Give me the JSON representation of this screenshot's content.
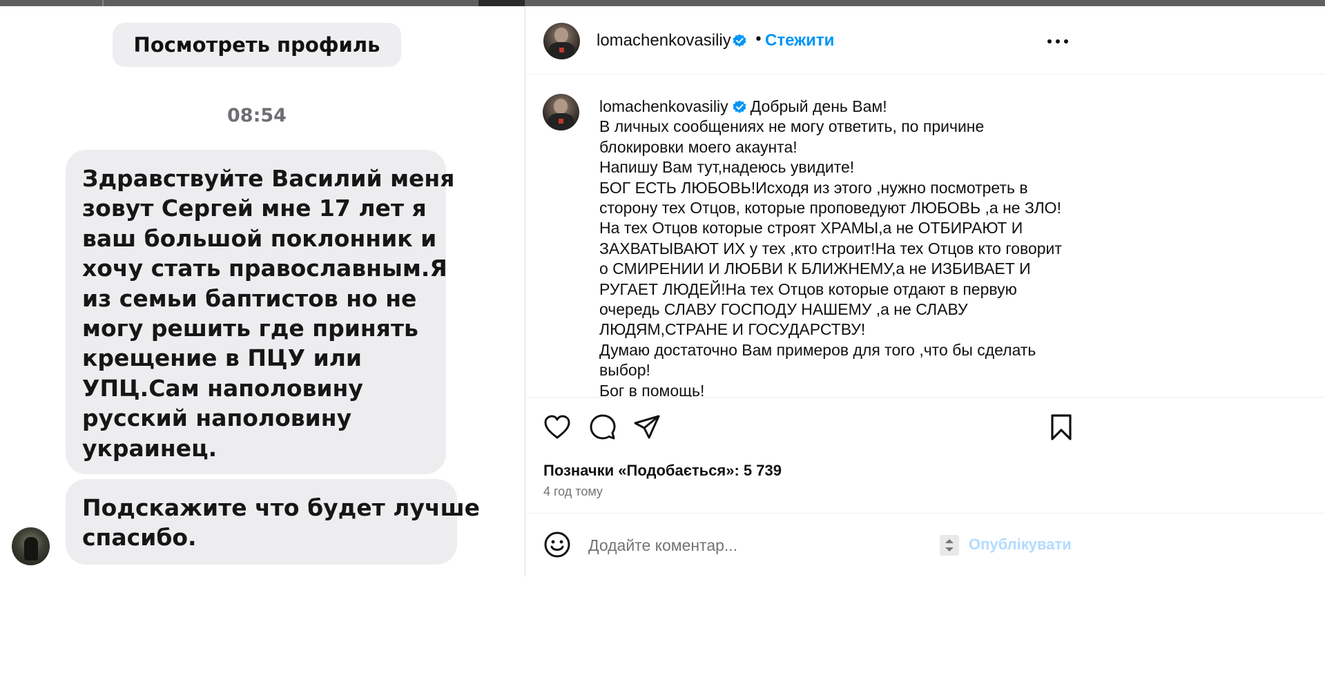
{
  "chat": {
    "profile_button": "Посмотреть профиль",
    "time": "08:54",
    "message_1_lines": [
      "Здравствуйте Василий меня",
      "зовут Сергей мне 17 лет я",
      "ваш большой поклонник и",
      "хочу стать православным.Я",
      "из семьи баптистов но не",
      "могу решить где принять",
      "крещение в ПЦУ или",
      "УПЦ.Сам наполовину",
      "русский наполовину",
      "украинец."
    ],
    "message_2_lines": [
      "Подскажите что будет лучше",
      "спасибо."
    ]
  },
  "post": {
    "header": {
      "username": "lomachenkovasiliy",
      "separator": "•",
      "follow_label": "Стежити"
    },
    "caption": {
      "username": "lomachenkovasiliy",
      "lines": [
        "Добрый день Вам!",
        "В личных сообщениях не могу ответить, по причине",
        "блокировки моего акаунта!",
        "Напишу Вам тут,надеюсь увидите!",
        "БОГ ЕСТЬ ЛЮБОВЬ!Исходя из этого ,нужно посмотреть в",
        "сторону тех Отцов, которые проповедуют ЛЮБОВЬ ,а не ЗЛО!",
        "На тех Отцов которые строят ХРАМЫ,а не ОТБИРАЮТ И",
        "ЗАХВАТЫВАЮТ ИХ у тех ,кто строит!На тех Отцов кто говорит",
        "о СМИРЕНИИ И ЛЮБВИ К БЛИЖНЕМУ,а не ИЗБИВАЕТ И",
        "РУГАЕТ ЛЮДЕЙ!На тех Отцов которые отдают в первую",
        "очередь СЛАВУ ГОСПОДУ НАШЕМУ ,а не СЛАВУ",
        "ЛЮДЯМ,СТРАНЕ И ГОСУДАРСТВУ!",
        "Думаю достаточно Вам примеров для того ,что бы сделать",
        "выбор!",
        "Бог в помощь!"
      ]
    },
    "likes_text": "Позначки «Подобається»: 5 739",
    "time_ago": "4 год тому",
    "comment": {
      "placeholder": "Додайте коментар...",
      "value": "",
      "publish_label": "Опублікувати"
    },
    "icons": {
      "like": "heart-icon",
      "comment": "comment-bubble-icon",
      "share": "paper-plane-icon",
      "save": "bookmark-icon",
      "more": "more-dots-icon",
      "emoji": "emoji-smile-icon",
      "verified": "verified-badge-icon"
    },
    "colors": {
      "link_blue": "#0095f6",
      "verified_blue": "#0095f6",
      "publish_disabled": "#b3dbff",
      "secondary_text": "#737373"
    }
  }
}
